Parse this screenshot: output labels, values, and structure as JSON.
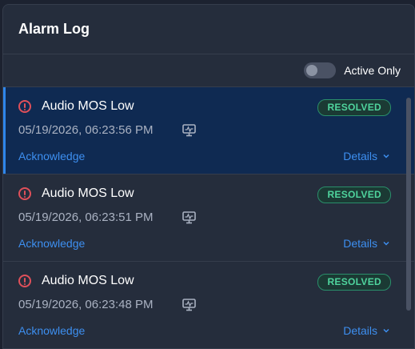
{
  "header": {
    "title": "Alarm Log"
  },
  "filter": {
    "toggle_label": "Active Only",
    "active_only": false
  },
  "alarms": [
    {
      "name": "Audio MOS Low",
      "status": "RESOLVED",
      "timestamp": "05/19/2026, 06:23:56 PM",
      "acknowledge_label": "Acknowledge",
      "details_label": "Details"
    },
    {
      "name": "Audio MOS Low",
      "status": "RESOLVED",
      "timestamp": "05/19/2026, 06:23:51 PM",
      "acknowledge_label": "Acknowledge",
      "details_label": "Details"
    },
    {
      "name": "Audio MOS Low",
      "status": "RESOLVED",
      "timestamp": "05/19/2026, 06:23:48 PM",
      "acknowledge_label": "Acknowledge",
      "details_label": "Details"
    }
  ],
  "icons": {
    "alarm": "alert-circle-icon",
    "monitor": "monitor-icon",
    "expand": "chevron-down-icon"
  },
  "colors": {
    "accent": "#3d8ff0",
    "alert": "#e0505a",
    "resolved": "#4fd49d",
    "selected_bg": "#0f2a52"
  }
}
